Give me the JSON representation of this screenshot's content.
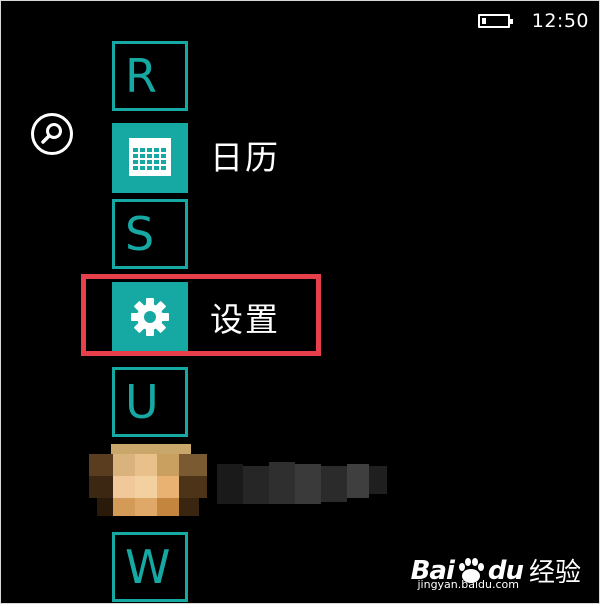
{
  "status_bar": {
    "time": "12:50",
    "battery_level": 0.15
  },
  "search": {
    "icon": "search-icon"
  },
  "app_list": {
    "items": [
      {
        "type": "letter",
        "label": "R"
      },
      {
        "type": "app",
        "label": "日历",
        "icon": "calendar-icon"
      },
      {
        "type": "letter",
        "label": "S"
      },
      {
        "type": "app",
        "label": "设置",
        "icon": "gear-icon",
        "highlighted": true
      },
      {
        "type": "letter",
        "label": "U"
      },
      {
        "type": "app",
        "label": "",
        "icon": "pixelated-app-icon",
        "obscured": true
      },
      {
        "type": "letter",
        "label": "W"
      }
    ]
  },
  "annotation": {
    "highlight_color": "#e8404a"
  },
  "watermark": {
    "brand_bai": "Bai",
    "brand_du": "du",
    "product": "经验",
    "url": "jingyan.baidu.com"
  },
  "colors": {
    "tile_accent": "#16a8a2",
    "background": "#000000",
    "text": "#ffffff"
  }
}
